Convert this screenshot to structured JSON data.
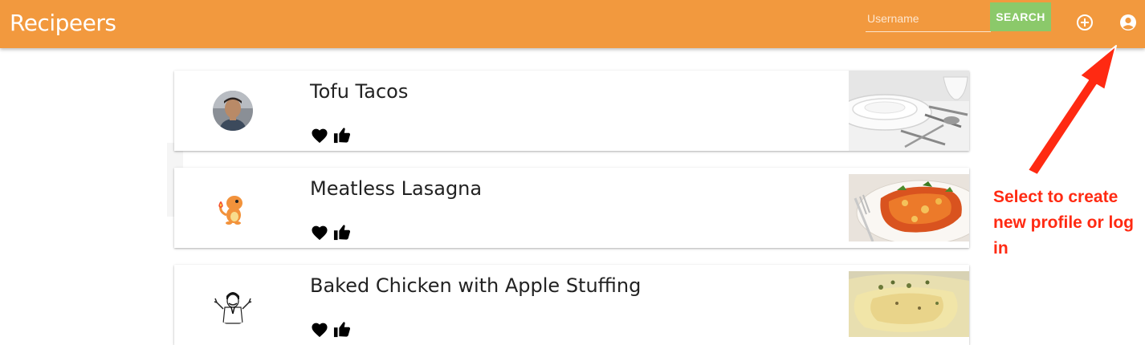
{
  "app": {
    "title": "Recipeers",
    "brand_color": "#f2993e"
  },
  "search": {
    "placeholder": "Username",
    "button_label": "SEARCH",
    "button_color": "#8bc96a"
  },
  "toolbar": {
    "add_icon": "add-circle-icon",
    "account_icon": "account-circle-icon"
  },
  "recipes": [
    {
      "title": "Tofu Tacos",
      "avatar": "user-photo-avatar",
      "image": "place-setting-photo",
      "actions": [
        "heart-icon",
        "thumbs-up-icon"
      ]
    },
    {
      "title": "Meatless Lasagna",
      "avatar": "charmander-avatar",
      "image": "lasagna-photo",
      "actions": [
        "heart-icon",
        "thumbs-up-icon"
      ]
    },
    {
      "title": "Baked Chicken with Apple Stuffing",
      "avatar": "meme-face-avatar",
      "image": "baked-chicken-photo",
      "actions": [
        "heart-icon",
        "thumbs-up-icon"
      ]
    }
  ],
  "annotation": {
    "text": "Select to create new profile or log in",
    "color": "#ff2a12"
  }
}
